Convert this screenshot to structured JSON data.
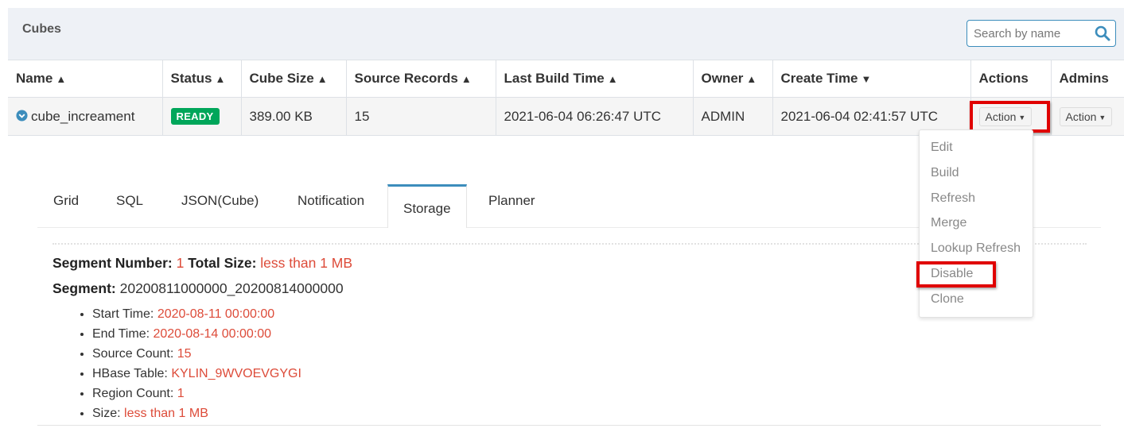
{
  "header": {
    "title": "Cubes"
  },
  "search": {
    "placeholder": "Search by name",
    "value": "",
    "icon": "search-icon"
  },
  "table": {
    "columns": [
      "Name",
      "Status",
      "Cube Size",
      "Source Records",
      "Last Build Time",
      "Owner",
      "Create Time",
      "Actions",
      "Admins"
    ],
    "row": {
      "name": "cube_increament",
      "status": "READY",
      "cube_size": "389.00 KB",
      "source_records": "15",
      "last_build_time": "2021-06-04 06:26:47 UTC",
      "owner": "ADMIN",
      "create_time": "2021-06-04 02:41:57 UTC",
      "action_label": "Action",
      "admin_action_label": "Action"
    }
  },
  "tabs": [
    "Grid",
    "SQL",
    "JSON(Cube)",
    "Notification",
    "Storage",
    "Planner"
  ],
  "active_tab": "Storage",
  "storage": {
    "segment_number_label": "Segment Number:",
    "segment_number": "1",
    "total_size_label": "Total Size:",
    "total_size": "less than 1 MB",
    "segment_label": "Segment:",
    "segment_name": "20200811000000_20200814000000",
    "details": [
      {
        "label": "Start Time:",
        "value": "2020-08-11 00:00:00"
      },
      {
        "label": "End Time:",
        "value": "2020-08-14 00:00:00"
      },
      {
        "label": "Source Count:",
        "value": "15"
      },
      {
        "label": "HBase Table:",
        "value": "KYLIN_9WVOEVGYGI"
      },
      {
        "label": "Region Count:",
        "value": "1"
      },
      {
        "label": "Size:",
        "value": "less than 1 MB"
      }
    ]
  },
  "dropdown": {
    "items": [
      "Edit",
      "Build",
      "Refresh",
      "Merge",
      "Lookup Refresh",
      "Disable",
      "Clone"
    ]
  },
  "colors": {
    "accent": "#3c8dbc",
    "ready_badge": "#00a65a",
    "value_red": "#dd4b39",
    "highlight": "#e00000"
  }
}
